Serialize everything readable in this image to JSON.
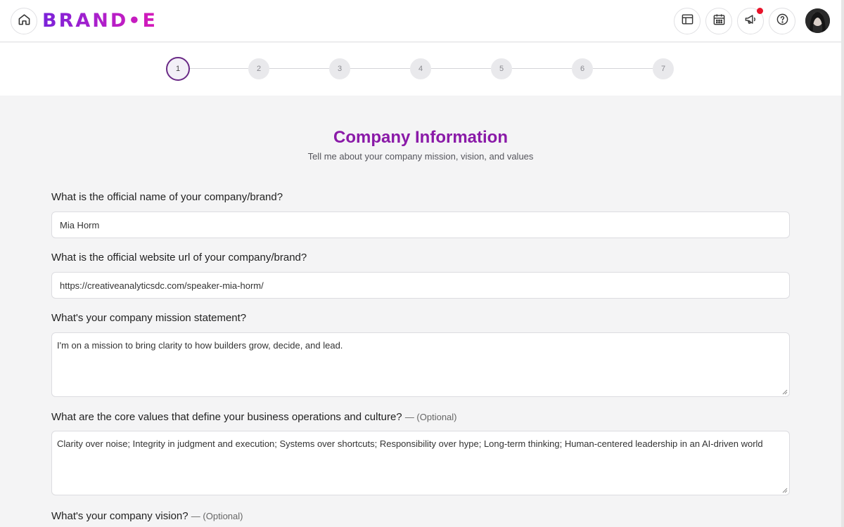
{
  "header": {
    "logo_text": "BRAND•E",
    "icons": [
      "home-icon",
      "layout-icon",
      "calendar-icon",
      "megaphone-icon",
      "help-icon"
    ],
    "notification_color": "#e8132a"
  },
  "stepper": {
    "steps": [
      "1",
      "2",
      "3",
      "4",
      "5",
      "6",
      "7"
    ],
    "current_step": 1,
    "accent": "#6a2a86"
  },
  "page": {
    "title": "Company Information",
    "subtitle": "Tell me about your company mission, vision, and values",
    "title_color": "#8a1aa8"
  },
  "form": {
    "name": {
      "label": "What is the official name of your company/brand?",
      "value": "Mia Horm"
    },
    "website": {
      "label": "What is the official website url of your company/brand?",
      "value": "https://creativeanalyticsdc.com/speaker-mia-horm/"
    },
    "mission": {
      "label": "What's your company mission statement?",
      "value": "I'm on a mission to bring clarity to how builders grow, decide, and lead."
    },
    "values": {
      "label": "What are the core values that define your business operations and culture?",
      "optional": "— (Optional)",
      "value": "Clarity over noise; Integrity in judgment and execution; Systems over shortcuts; Responsibility over hype; Long-term thinking; Human-centered leadership in an AI-driven world"
    },
    "vision": {
      "label": "What's your company vision?",
      "optional": "— (Optional)"
    }
  }
}
